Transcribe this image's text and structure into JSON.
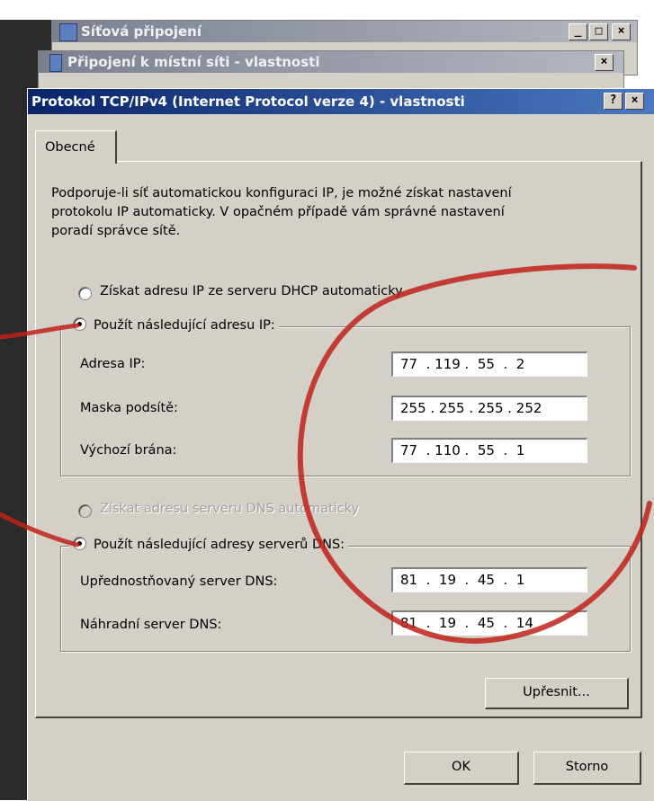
{
  "background_windows": [
    {
      "title": "Síťová připojení",
      "buttons": [
        "_",
        "□",
        "×"
      ]
    },
    {
      "title": "Připojení k místní síti - vlastnosti",
      "buttons": [
        "×"
      ]
    }
  ],
  "dialog": {
    "title": "Protokol TCP/IPv4 (Internet Protocol verze 4) - vlastnosti",
    "help_button": "?",
    "close_button": "×",
    "tab": "Obecné",
    "description": [
      "Podporuje-li síť automatickou konfiguraci IP, je možné získat nastavení",
      "protokolu IP automaticky. V opačném případě vám správné nastavení",
      "poradí správce sítě."
    ],
    "ip_section": {
      "radio_auto": "Získat adresu IP ze serveru DHCP automaticky",
      "radio_manual": "Použít následující adresu IP:",
      "selected": "manual",
      "fields": [
        {
          "label": "Adresa IP:",
          "value": "77  . 119 .  55  .  2"
        },
        {
          "label": "Maska podsítě:",
          "value": "255 . 255 . 255 . 252"
        },
        {
          "label": "Výchozí brána:",
          "value": "77  . 110 .  55  .  1"
        }
      ]
    },
    "dns_section": {
      "radio_auto": "Získat adresu serveru DNS automaticky",
      "radio_manual": "Použít následující adresy serverů DNS:",
      "selected": "manual",
      "fields": [
        {
          "label": "Upřednostňovaný server DNS:",
          "value": "81  .  19  .  45  .  1"
        },
        {
          "label": "Náhradní server DNS:",
          "value": "81  .  19  .  45  .  14"
        }
      ]
    },
    "advanced_button": "Upřesnit...",
    "ok_button": "OK",
    "cancel_button": "Storno"
  },
  "colors": {
    "dialog_face": "#d4d0c8",
    "active_title": "#0a246a",
    "annotation_red": "#c0221a"
  }
}
